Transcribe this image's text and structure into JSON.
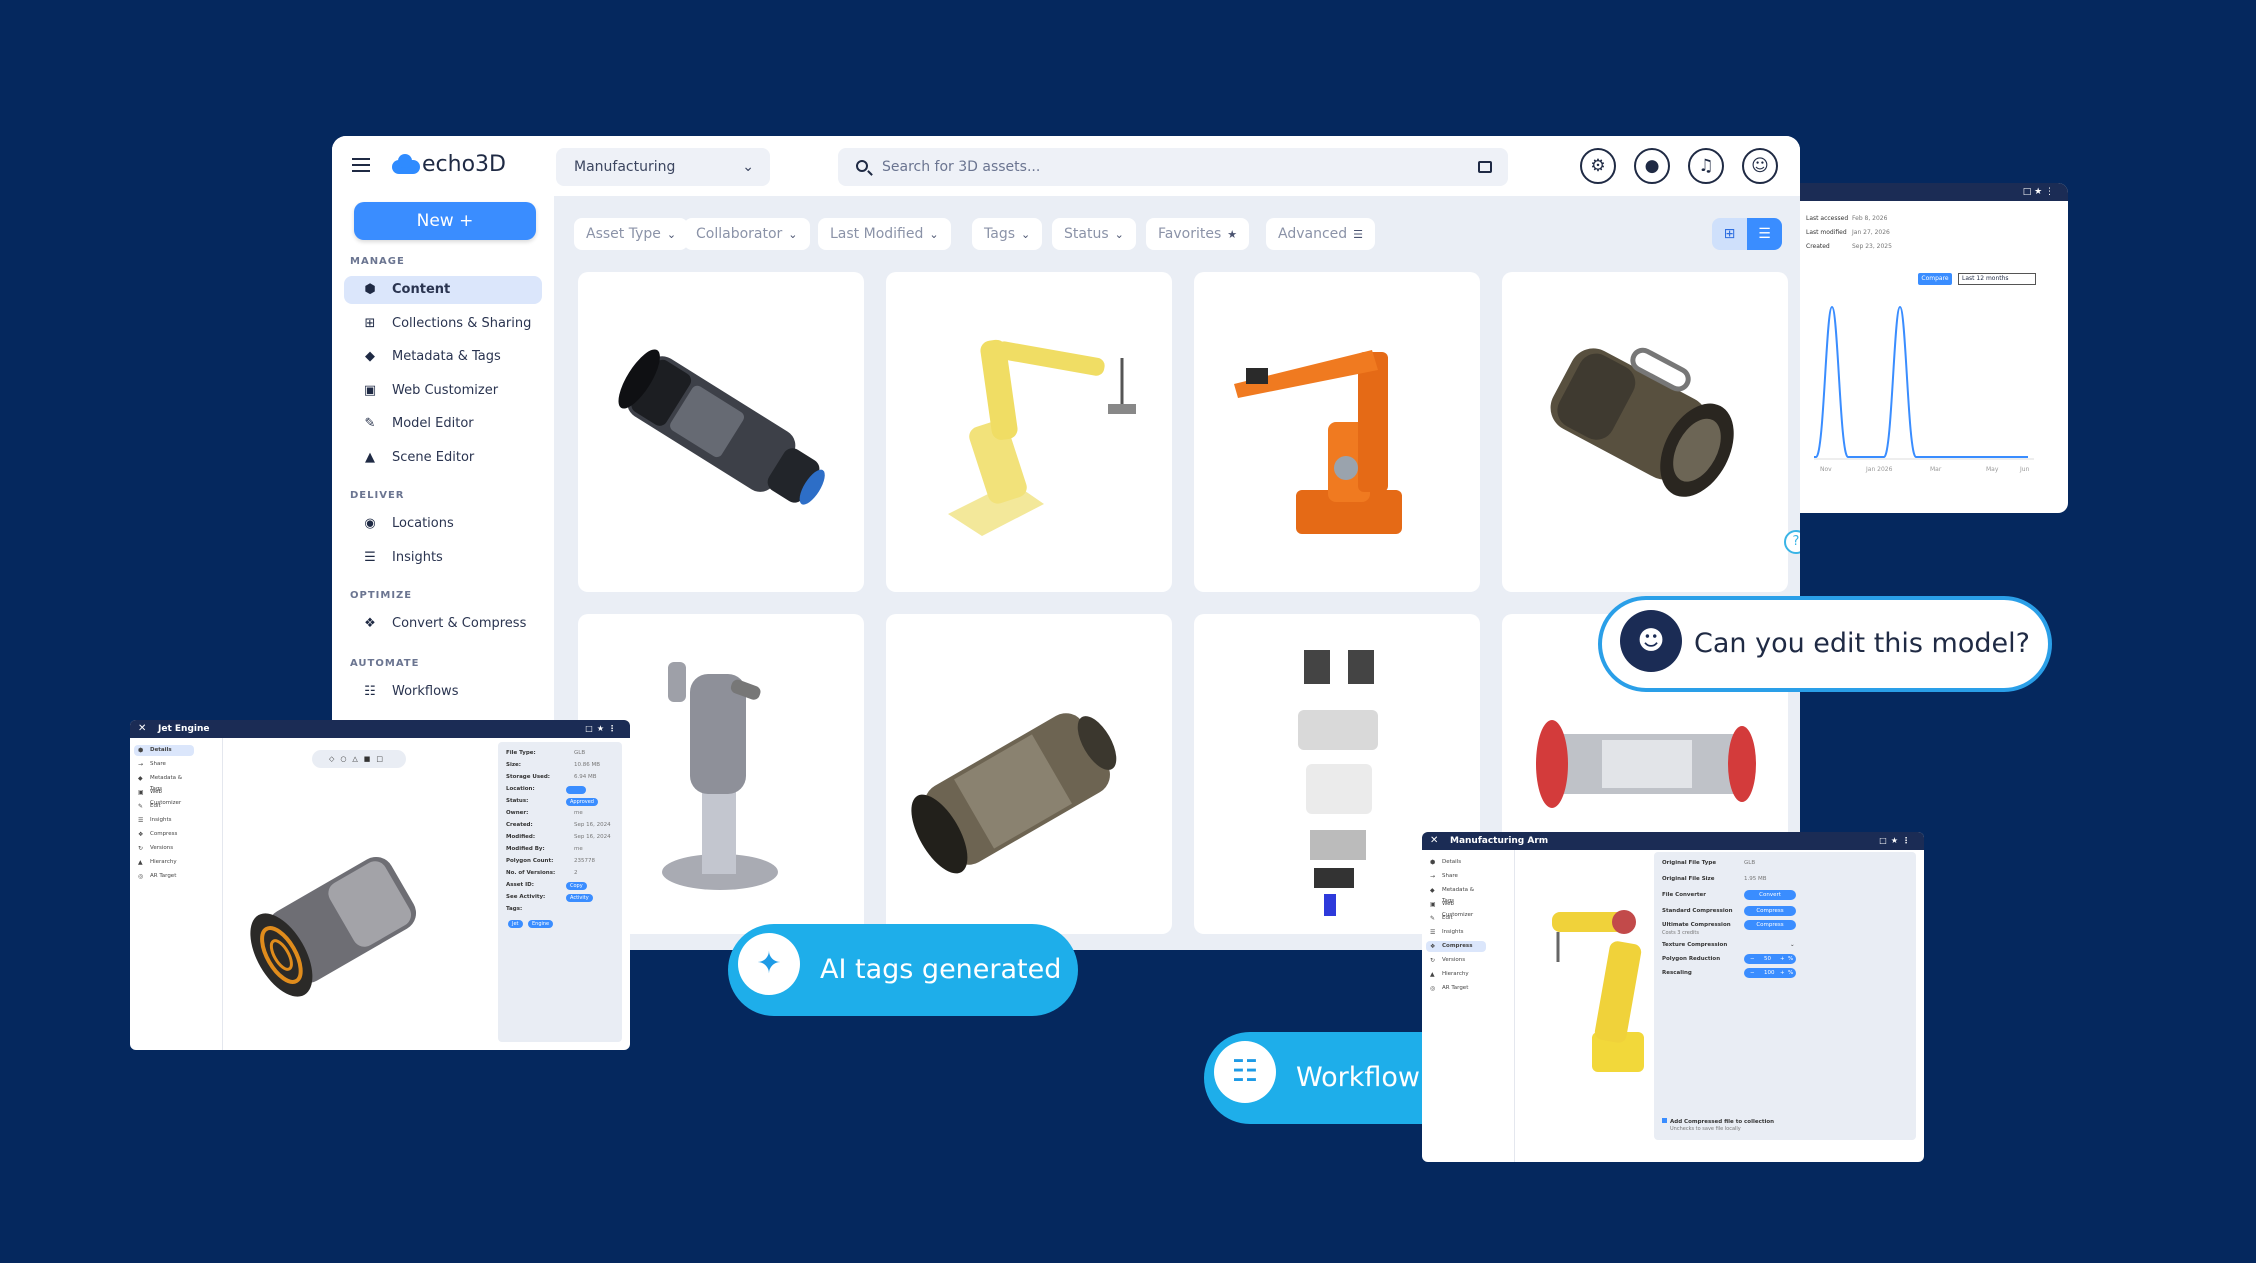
{
  "app": {
    "brand": "echo3D",
    "project": "Manufacturing",
    "search_placeholder": "Search for 3D assets..."
  },
  "sidebar": {
    "new_label": "New +",
    "sections": {
      "manage": "MANAGE",
      "deliver": "DELIVER",
      "optimize": "OPTIMIZE",
      "automate": "AUTOMATE"
    },
    "items": [
      "Content",
      "Collections & Sharing",
      "Metadata & Tags",
      "Web Customizer",
      "Model Editor",
      "Scene Editor",
      "Locations",
      "Insights",
      "Convert & Compress",
      "Workflows"
    ]
  },
  "filters": [
    "Asset Type",
    "Collaborator",
    "Last Modified",
    "Tags",
    "Status",
    "Favorites",
    "Advanced"
  ],
  "analytics": {
    "rows": [
      {
        "label": "Last accessed",
        "value": "Feb 8, 2026"
      },
      {
        "label": "Last modified",
        "value": "Jan 27, 2026"
      },
      {
        "label": "Created",
        "value": "Sep 23, 2025"
      }
    ],
    "compare_label": "Compare",
    "range_label": "Last 12 months",
    "x_ticks": [
      "Nov",
      "Jan 2026",
      "Mar",
      "May",
      "Jun"
    ]
  },
  "pills": {
    "edit": "Can you edit this model?",
    "ai": "AI tags generated",
    "workflow": "Workflow initiated"
  },
  "jet": {
    "title": "Jet Engine",
    "nav": [
      "Details",
      "Share",
      "Metadata & Tags",
      "Web Customizer",
      "Edit",
      "Insights",
      "Compress",
      "Versions",
      "Hierarchy",
      "AR Target"
    ],
    "props": [
      {
        "label": "File Type:",
        "value": "GLB"
      },
      {
        "label": "Size:",
        "value": "10.86 MB"
      },
      {
        "label": "Storage Used:",
        "value": "6.94 MB"
      },
      {
        "label": "Location:",
        "value": ""
      },
      {
        "label": "Status:",
        "value": ""
      },
      {
        "label": "Owner:",
        "value": "me"
      },
      {
        "label": "Created:",
        "value": "Sep 16, 2024"
      },
      {
        "label": "Modified:",
        "value": "Sep 16, 2024"
      },
      {
        "label": "Modified By:",
        "value": "me"
      },
      {
        "label": "Polygon Count:",
        "value": "235778"
      },
      {
        "label": "No. of Versions:",
        "value": "2"
      },
      {
        "label": "Asset ID:",
        "value": ""
      },
      {
        "label": "See Activity:",
        "value": ""
      },
      {
        "label": "Tags:",
        "value": ""
      }
    ],
    "status_badge": "Approved",
    "asset_id_badge": "Copy",
    "activity_badge": "Activity",
    "tags": [
      "Jet",
      "Engine"
    ]
  },
  "arm": {
    "title": "Manufacturing Arm",
    "nav": [
      "Details",
      "Share",
      "Metadata & Tags",
      "Web Customizer",
      "Edit",
      "Insights",
      "Compress",
      "Versions",
      "Hierarchy",
      "AR Target"
    ],
    "original_type_label": "Original File Type",
    "original_type": "GLB",
    "original_size_label": "Original File Size",
    "original_size": "1.95 MB",
    "converter_label": "File Converter",
    "convert_btn": "Convert",
    "standard_label": "Standard Compression",
    "compress_btn": "Compress",
    "ultimate_label": "Ultimate Compression",
    "ultimate_note": "Costs 3 credits",
    "texture_label": "Texture Compression",
    "polygon_label": "Polygon Reduction",
    "polygon_value": "50",
    "rescaling_label": "Rescaling",
    "rescaling_value": "100",
    "add_label": "Add Compressed file to collection",
    "add_note": "Unchecks to save file locally"
  }
}
